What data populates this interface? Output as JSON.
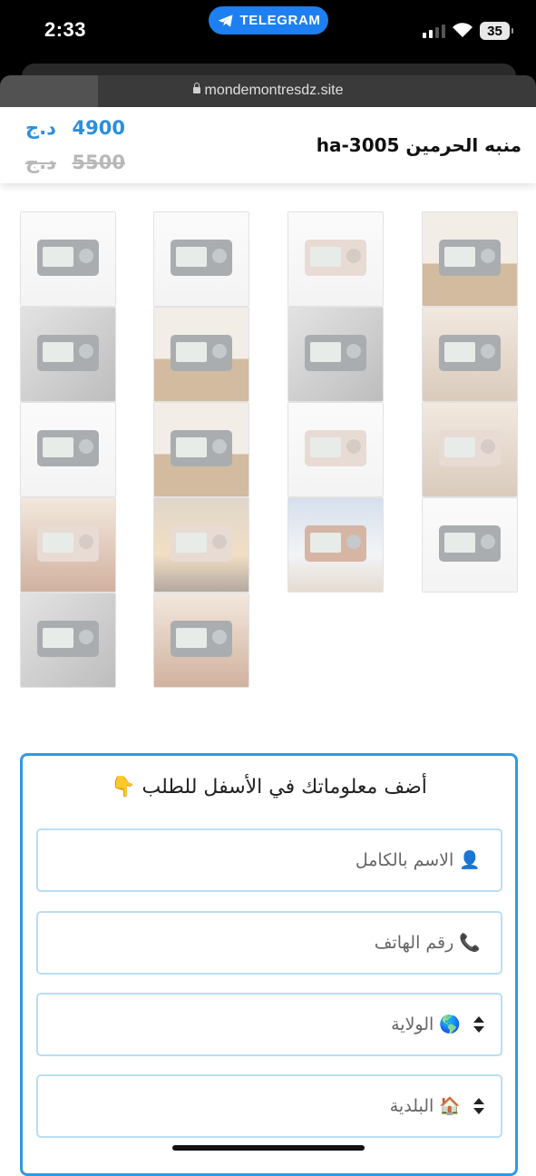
{
  "status_bar": {
    "time": "2:33",
    "pill_label": "TELEGRAM",
    "battery": "35"
  },
  "browser": {
    "url": "mondemontresdz.site"
  },
  "product": {
    "title": "منبه الحرمين ha-3005",
    "price_value": "4900",
    "price_currency": "د.ج",
    "old_price_value": "5500",
    "old_price_currency": "د.ج"
  },
  "gallery": {
    "images": [
      {
        "name": "two-clocks-white",
        "style": "plain",
        "clock": "dark"
      },
      {
        "name": "dark-clock-front",
        "style": "plain",
        "clock": "dark"
      },
      {
        "name": "rose-clock-front",
        "style": "plain",
        "clock": "rose"
      },
      {
        "name": "clock-on-table",
        "style": "wood",
        "clock": "dark"
      },
      {
        "name": "clock-closeup-buttons",
        "style": "grey",
        "clock": "dark"
      },
      {
        "name": "clock-on-desk",
        "style": "wood",
        "clock": "dark"
      },
      {
        "name": "clock-parts",
        "style": "grey",
        "clock": "dark"
      },
      {
        "name": "clock-in-room-circle",
        "style": "room",
        "clock": "dark"
      },
      {
        "name": "clock-side-view",
        "style": "plain",
        "clock": "dark"
      },
      {
        "name": "clock-prayer-mat",
        "style": "wood",
        "clock": "dark"
      },
      {
        "name": "clock-on-shelf",
        "style": "plain",
        "clock": "rose"
      },
      {
        "name": "clock-living-room",
        "style": "room",
        "clock": "rose"
      },
      {
        "name": "mosque-interior-circle",
        "style": "mosque",
        "clock": "rose"
      },
      {
        "name": "rose-clock-city",
        "style": "city",
        "clock": "rose"
      },
      {
        "name": "copper-clock-tajmahal",
        "style": "sky",
        "clock": "copper"
      },
      {
        "name": "two-clocks-white-2",
        "style": "plain",
        "clock": "dark"
      },
      {
        "name": "clock-diagram",
        "style": "grey",
        "clock": "dark"
      },
      {
        "name": "two-clocks-mosque",
        "style": "mosque",
        "clock": "dark"
      }
    ]
  },
  "order_form": {
    "title": "أضف معلوماتك في الأسفل للطلب 👇",
    "full_name_placeholder": "👤 الاسم بالكامل",
    "phone_placeholder": "📞 رقم الهاتف",
    "wilaya_label": "🌎 الولاية",
    "commune_label": "🏠 البلدية"
  },
  "colors": {
    "accent": "#2f9ae0",
    "price": "#2b8fdc",
    "telegram": "#1d7ff2"
  }
}
